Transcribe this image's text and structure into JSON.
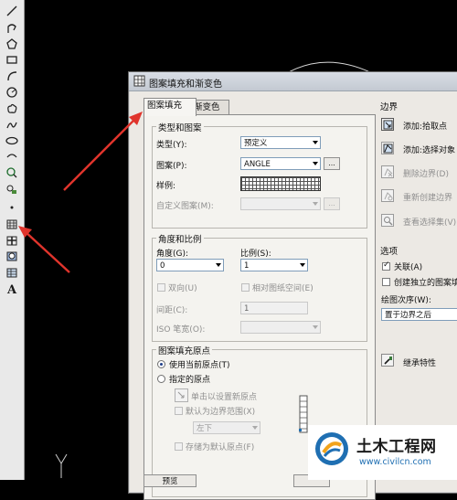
{
  "toolbar": {
    "tools": [
      "line-tool",
      "polyline-tool",
      "polygon-tool",
      "rectangle-tool",
      "arc-tool",
      "circle-tool",
      "revcloud-tool",
      "spline-tool",
      "ellipse-tool",
      "ellipse-arc-tool",
      "insert-block-tool",
      "make-block-tool",
      "point-tool",
      "hatch-tool",
      "gradient-tool",
      "region-tool",
      "table-tool",
      "multiline-text-tool"
    ],
    "text_tool_label": "A"
  },
  "dialog": {
    "title": "图案填充和渐变色",
    "tabs": [
      "图案填充",
      "渐变色"
    ],
    "type_and_pattern": {
      "group_title": "类型和图案",
      "type_label": "类型(Y):",
      "type_value": "预定义",
      "pattern_label": "图案(P):",
      "pattern_value": "ANGLE",
      "pattern_browse": "...",
      "swatch_label": "样例:",
      "custom_label": "自定义图案(M):",
      "custom_browse": "..."
    },
    "angle_and_scale": {
      "group_title": "角度和比例",
      "angle_label": "角度(G):",
      "angle_value": "0",
      "scale_label": "比例(S):",
      "scale_value": "1",
      "double_label": "双向(U)",
      "relative_label": "相对图纸空间(E)",
      "spacing_label": "间距(C):",
      "spacing_value": "1",
      "iso_label": "ISO 笔宽(O):"
    },
    "origin": {
      "group_title": "图案填充原点",
      "use_current_label": "使用当前原点(T)",
      "specified_label": "指定的原点",
      "click_set_label": "单击以设置新原点",
      "default_extent_label": "默认为边界范围(X)",
      "extent_value": "左下",
      "store_default_label": "存储为默认原点(F)"
    },
    "boundary": {
      "title": "边界",
      "add_pick_label": "添加:拾取点",
      "add_select_label": "添加:选择对象",
      "remove_label": "删除边界(D)",
      "recreate_label": "重新创建边界",
      "view_selection_label": "查看选择集(V)"
    },
    "options": {
      "title": "选项",
      "associative_label": "关联(A)",
      "associative_checked": true,
      "separate_label": "创建独立的图案填充",
      "draw_order_label": "绘图次序(W):",
      "draw_order_value": "置于边界之后"
    },
    "inherit_label": "继承特性",
    "preview_label": "预览"
  },
  "watermark": {
    "title": "土木工程网",
    "url": "www.civilcn.com"
  },
  "colors": {
    "arrow": "#e0342c",
    "canvas": "#000000",
    "dialog_bg": "#ece9e4",
    "watermark_url": "#1f6fb2"
  }
}
